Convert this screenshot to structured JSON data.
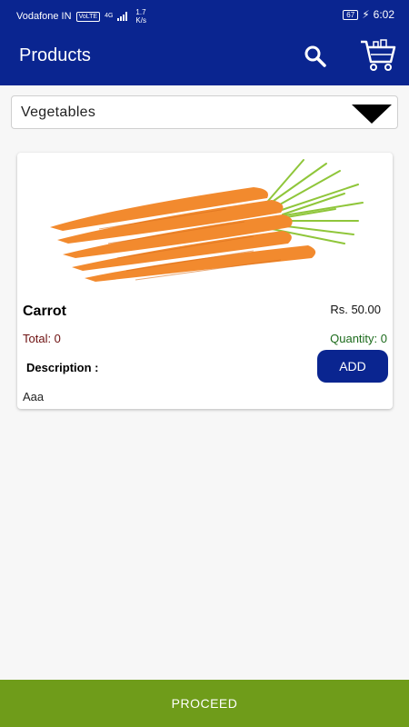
{
  "status_bar": {
    "carrier": "Vodafone IN",
    "volte": "VoLTE",
    "network": "4G",
    "speed_value": "1.7",
    "speed_unit": "K/s",
    "battery": "67",
    "time": "6:02"
  },
  "app_bar": {
    "title": "Products",
    "search_icon": "search-icon",
    "cart_icon": "cart-icon",
    "color": "#0a2590"
  },
  "category_select": {
    "selected": "Vegetables"
  },
  "products": [
    {
      "name": "Carrot",
      "price": "Rs. 50.00",
      "total": "Total: 0",
      "quantity": "Quantity: 0",
      "description_label": "Description :",
      "description": "Aaa",
      "add_label": "ADD"
    }
  ],
  "footer": {
    "proceed_label": "PROCEED",
    "color": "#6f9c1a"
  }
}
